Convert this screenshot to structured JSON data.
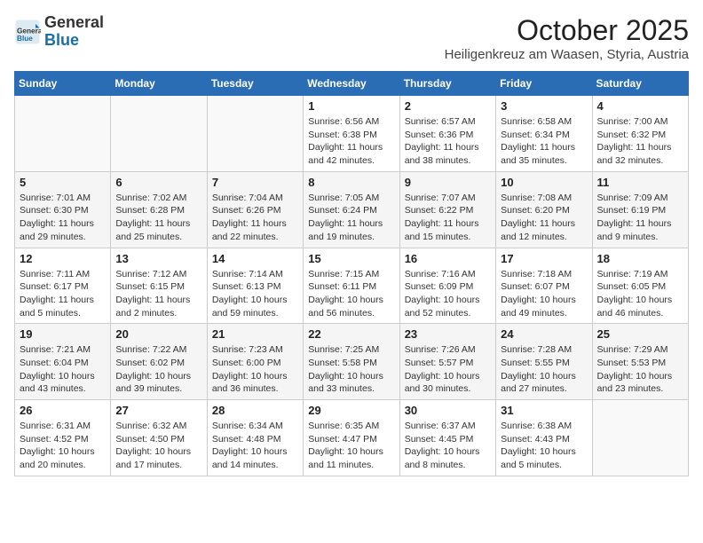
{
  "header": {
    "logo_general": "General",
    "logo_blue": "Blue",
    "month_title": "October 2025",
    "subtitle": "Heiligenkreuz am Waasen, Styria, Austria"
  },
  "days_of_week": [
    "Sunday",
    "Monday",
    "Tuesday",
    "Wednesday",
    "Thursday",
    "Friday",
    "Saturday"
  ],
  "weeks": [
    [
      {
        "day": "",
        "sunrise": "",
        "sunset": "",
        "daylight": ""
      },
      {
        "day": "",
        "sunrise": "",
        "sunset": "",
        "daylight": ""
      },
      {
        "day": "",
        "sunrise": "",
        "sunset": "",
        "daylight": ""
      },
      {
        "day": "1",
        "sunrise": "Sunrise: 6:56 AM",
        "sunset": "Sunset: 6:38 PM",
        "daylight": "Daylight: 11 hours and 42 minutes."
      },
      {
        "day": "2",
        "sunrise": "Sunrise: 6:57 AM",
        "sunset": "Sunset: 6:36 PM",
        "daylight": "Daylight: 11 hours and 38 minutes."
      },
      {
        "day": "3",
        "sunrise": "Sunrise: 6:58 AM",
        "sunset": "Sunset: 6:34 PM",
        "daylight": "Daylight: 11 hours and 35 minutes."
      },
      {
        "day": "4",
        "sunrise": "Sunrise: 7:00 AM",
        "sunset": "Sunset: 6:32 PM",
        "daylight": "Daylight: 11 hours and 32 minutes."
      }
    ],
    [
      {
        "day": "5",
        "sunrise": "Sunrise: 7:01 AM",
        "sunset": "Sunset: 6:30 PM",
        "daylight": "Daylight: 11 hours and 29 minutes."
      },
      {
        "day": "6",
        "sunrise": "Sunrise: 7:02 AM",
        "sunset": "Sunset: 6:28 PM",
        "daylight": "Daylight: 11 hours and 25 minutes."
      },
      {
        "day": "7",
        "sunrise": "Sunrise: 7:04 AM",
        "sunset": "Sunset: 6:26 PM",
        "daylight": "Daylight: 11 hours and 22 minutes."
      },
      {
        "day": "8",
        "sunrise": "Sunrise: 7:05 AM",
        "sunset": "Sunset: 6:24 PM",
        "daylight": "Daylight: 11 hours and 19 minutes."
      },
      {
        "day": "9",
        "sunrise": "Sunrise: 7:07 AM",
        "sunset": "Sunset: 6:22 PM",
        "daylight": "Daylight: 11 hours and 15 minutes."
      },
      {
        "day": "10",
        "sunrise": "Sunrise: 7:08 AM",
        "sunset": "Sunset: 6:20 PM",
        "daylight": "Daylight: 11 hours and 12 minutes."
      },
      {
        "day": "11",
        "sunrise": "Sunrise: 7:09 AM",
        "sunset": "Sunset: 6:19 PM",
        "daylight": "Daylight: 11 hours and 9 minutes."
      }
    ],
    [
      {
        "day": "12",
        "sunrise": "Sunrise: 7:11 AM",
        "sunset": "Sunset: 6:17 PM",
        "daylight": "Daylight: 11 hours and 5 minutes."
      },
      {
        "day": "13",
        "sunrise": "Sunrise: 7:12 AM",
        "sunset": "Sunset: 6:15 PM",
        "daylight": "Daylight: 11 hours and 2 minutes."
      },
      {
        "day": "14",
        "sunrise": "Sunrise: 7:14 AM",
        "sunset": "Sunset: 6:13 PM",
        "daylight": "Daylight: 10 hours and 59 minutes."
      },
      {
        "day": "15",
        "sunrise": "Sunrise: 7:15 AM",
        "sunset": "Sunset: 6:11 PM",
        "daylight": "Daylight: 10 hours and 56 minutes."
      },
      {
        "day": "16",
        "sunrise": "Sunrise: 7:16 AM",
        "sunset": "Sunset: 6:09 PM",
        "daylight": "Daylight: 10 hours and 52 minutes."
      },
      {
        "day": "17",
        "sunrise": "Sunrise: 7:18 AM",
        "sunset": "Sunset: 6:07 PM",
        "daylight": "Daylight: 10 hours and 49 minutes."
      },
      {
        "day": "18",
        "sunrise": "Sunrise: 7:19 AM",
        "sunset": "Sunset: 6:05 PM",
        "daylight": "Daylight: 10 hours and 46 minutes."
      }
    ],
    [
      {
        "day": "19",
        "sunrise": "Sunrise: 7:21 AM",
        "sunset": "Sunset: 6:04 PM",
        "daylight": "Daylight: 10 hours and 43 minutes."
      },
      {
        "day": "20",
        "sunrise": "Sunrise: 7:22 AM",
        "sunset": "Sunset: 6:02 PM",
        "daylight": "Daylight: 10 hours and 39 minutes."
      },
      {
        "day": "21",
        "sunrise": "Sunrise: 7:23 AM",
        "sunset": "Sunset: 6:00 PM",
        "daylight": "Daylight: 10 hours and 36 minutes."
      },
      {
        "day": "22",
        "sunrise": "Sunrise: 7:25 AM",
        "sunset": "Sunset: 5:58 PM",
        "daylight": "Daylight: 10 hours and 33 minutes."
      },
      {
        "day": "23",
        "sunrise": "Sunrise: 7:26 AM",
        "sunset": "Sunset: 5:57 PM",
        "daylight": "Daylight: 10 hours and 30 minutes."
      },
      {
        "day": "24",
        "sunrise": "Sunrise: 7:28 AM",
        "sunset": "Sunset: 5:55 PM",
        "daylight": "Daylight: 10 hours and 27 minutes."
      },
      {
        "day": "25",
        "sunrise": "Sunrise: 7:29 AM",
        "sunset": "Sunset: 5:53 PM",
        "daylight": "Daylight: 10 hours and 23 minutes."
      }
    ],
    [
      {
        "day": "26",
        "sunrise": "Sunrise: 6:31 AM",
        "sunset": "Sunset: 4:52 PM",
        "daylight": "Daylight: 10 hours and 20 minutes."
      },
      {
        "day": "27",
        "sunrise": "Sunrise: 6:32 AM",
        "sunset": "Sunset: 4:50 PM",
        "daylight": "Daylight: 10 hours and 17 minutes."
      },
      {
        "day": "28",
        "sunrise": "Sunrise: 6:34 AM",
        "sunset": "Sunset: 4:48 PM",
        "daylight": "Daylight: 10 hours and 14 minutes."
      },
      {
        "day": "29",
        "sunrise": "Sunrise: 6:35 AM",
        "sunset": "Sunset: 4:47 PM",
        "daylight": "Daylight: 10 hours and 11 minutes."
      },
      {
        "day": "30",
        "sunrise": "Sunrise: 6:37 AM",
        "sunset": "Sunset: 4:45 PM",
        "daylight": "Daylight: 10 hours and 8 minutes."
      },
      {
        "day": "31",
        "sunrise": "Sunrise: 6:38 AM",
        "sunset": "Sunset: 4:43 PM",
        "daylight": "Daylight: 10 hours and 5 minutes."
      },
      {
        "day": "",
        "sunrise": "",
        "sunset": "",
        "daylight": ""
      }
    ]
  ]
}
